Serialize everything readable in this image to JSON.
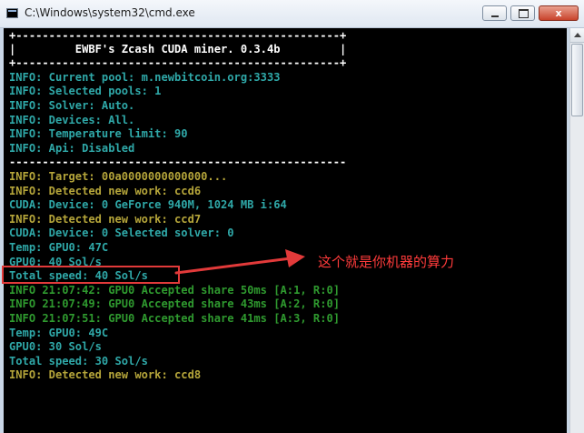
{
  "window": {
    "title": "C:\\Windows\\system32\\cmd.exe",
    "minimize_label": "",
    "maximize_label": "",
    "close_label": "x"
  },
  "console": {
    "lines": [
      "+-------------------------------------------------+",
      "|         EWBF's Zcash CUDA miner. 0.3.4b         |",
      "+-------------------------------------------------+",
      "INFO: Current pool: m.newbitcoin.org:3333",
      "INFO: Selected pools: 1",
      "INFO: Solver: Auto.",
      "INFO: Devices: All.",
      "INFO: Temperature limit: 90",
      "INFO: Api: Disabled",
      "---------------------------------------------------",
      "INFO: Target: 00a0000000000000...",
      "INFO: Detected new work: ccd6",
      "CUDA: Device: 0 GeForce 940M, 1024 MB i:64",
      "INFO: Detected new work: ccd7",
      "CUDA: Device: 0 Selected solver: 0",
      "Temp: GPU0: 47C",
      "GPU0: 40 Sol/s",
      "Total speed: 40 Sol/s",
      "INFO 21:07:42: GPU0 Accepted share 50ms [A:1, R:0]",
      "INFO 21:07:49: GPU0 Accepted share 43ms [A:2, R:0]",
      "INFO 21:07:51: GPU0 Accepted share 41ms [A:3, R:0]",
      "Temp: GPU0: 49C",
      "GPU0: 30 Sol/s",
      "Total speed: 30 Sol/s",
      "INFO: Detected new work: ccd8"
    ]
  },
  "annotation": {
    "text": "这个就是你机器的算力",
    "color": "#ff3b3b"
  },
  "colors": {
    "white": "#ffffff",
    "cyan": "#2fa8a8",
    "yellow": "#b5a53a",
    "green": "#2f9a2f",
    "console_bg": "#000000"
  }
}
